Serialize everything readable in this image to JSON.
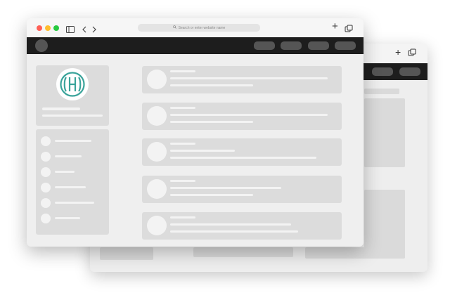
{
  "back_window": {
    "toolbar": {
      "new_tab_label": "+",
      "tabs_icon": "tabs-overview-icon"
    }
  },
  "front_window": {
    "toolbar": {
      "traffic_light_colors": [
        "#ff5f56",
        "#ffbd2e",
        "#27c93f"
      ],
      "sidebar_icon": "sidebar-icon",
      "back_icon": "chevron-left-icon",
      "forward_icon": "chevron-right-icon",
      "address_placeholder": "Search or enter website name",
      "new_tab_label": "+",
      "tabs_icon": "tabs-overview-icon"
    },
    "profile": {
      "logo_icon": "monogram-logo-icon",
      "logo_color": "#3aa39a"
    }
  }
}
